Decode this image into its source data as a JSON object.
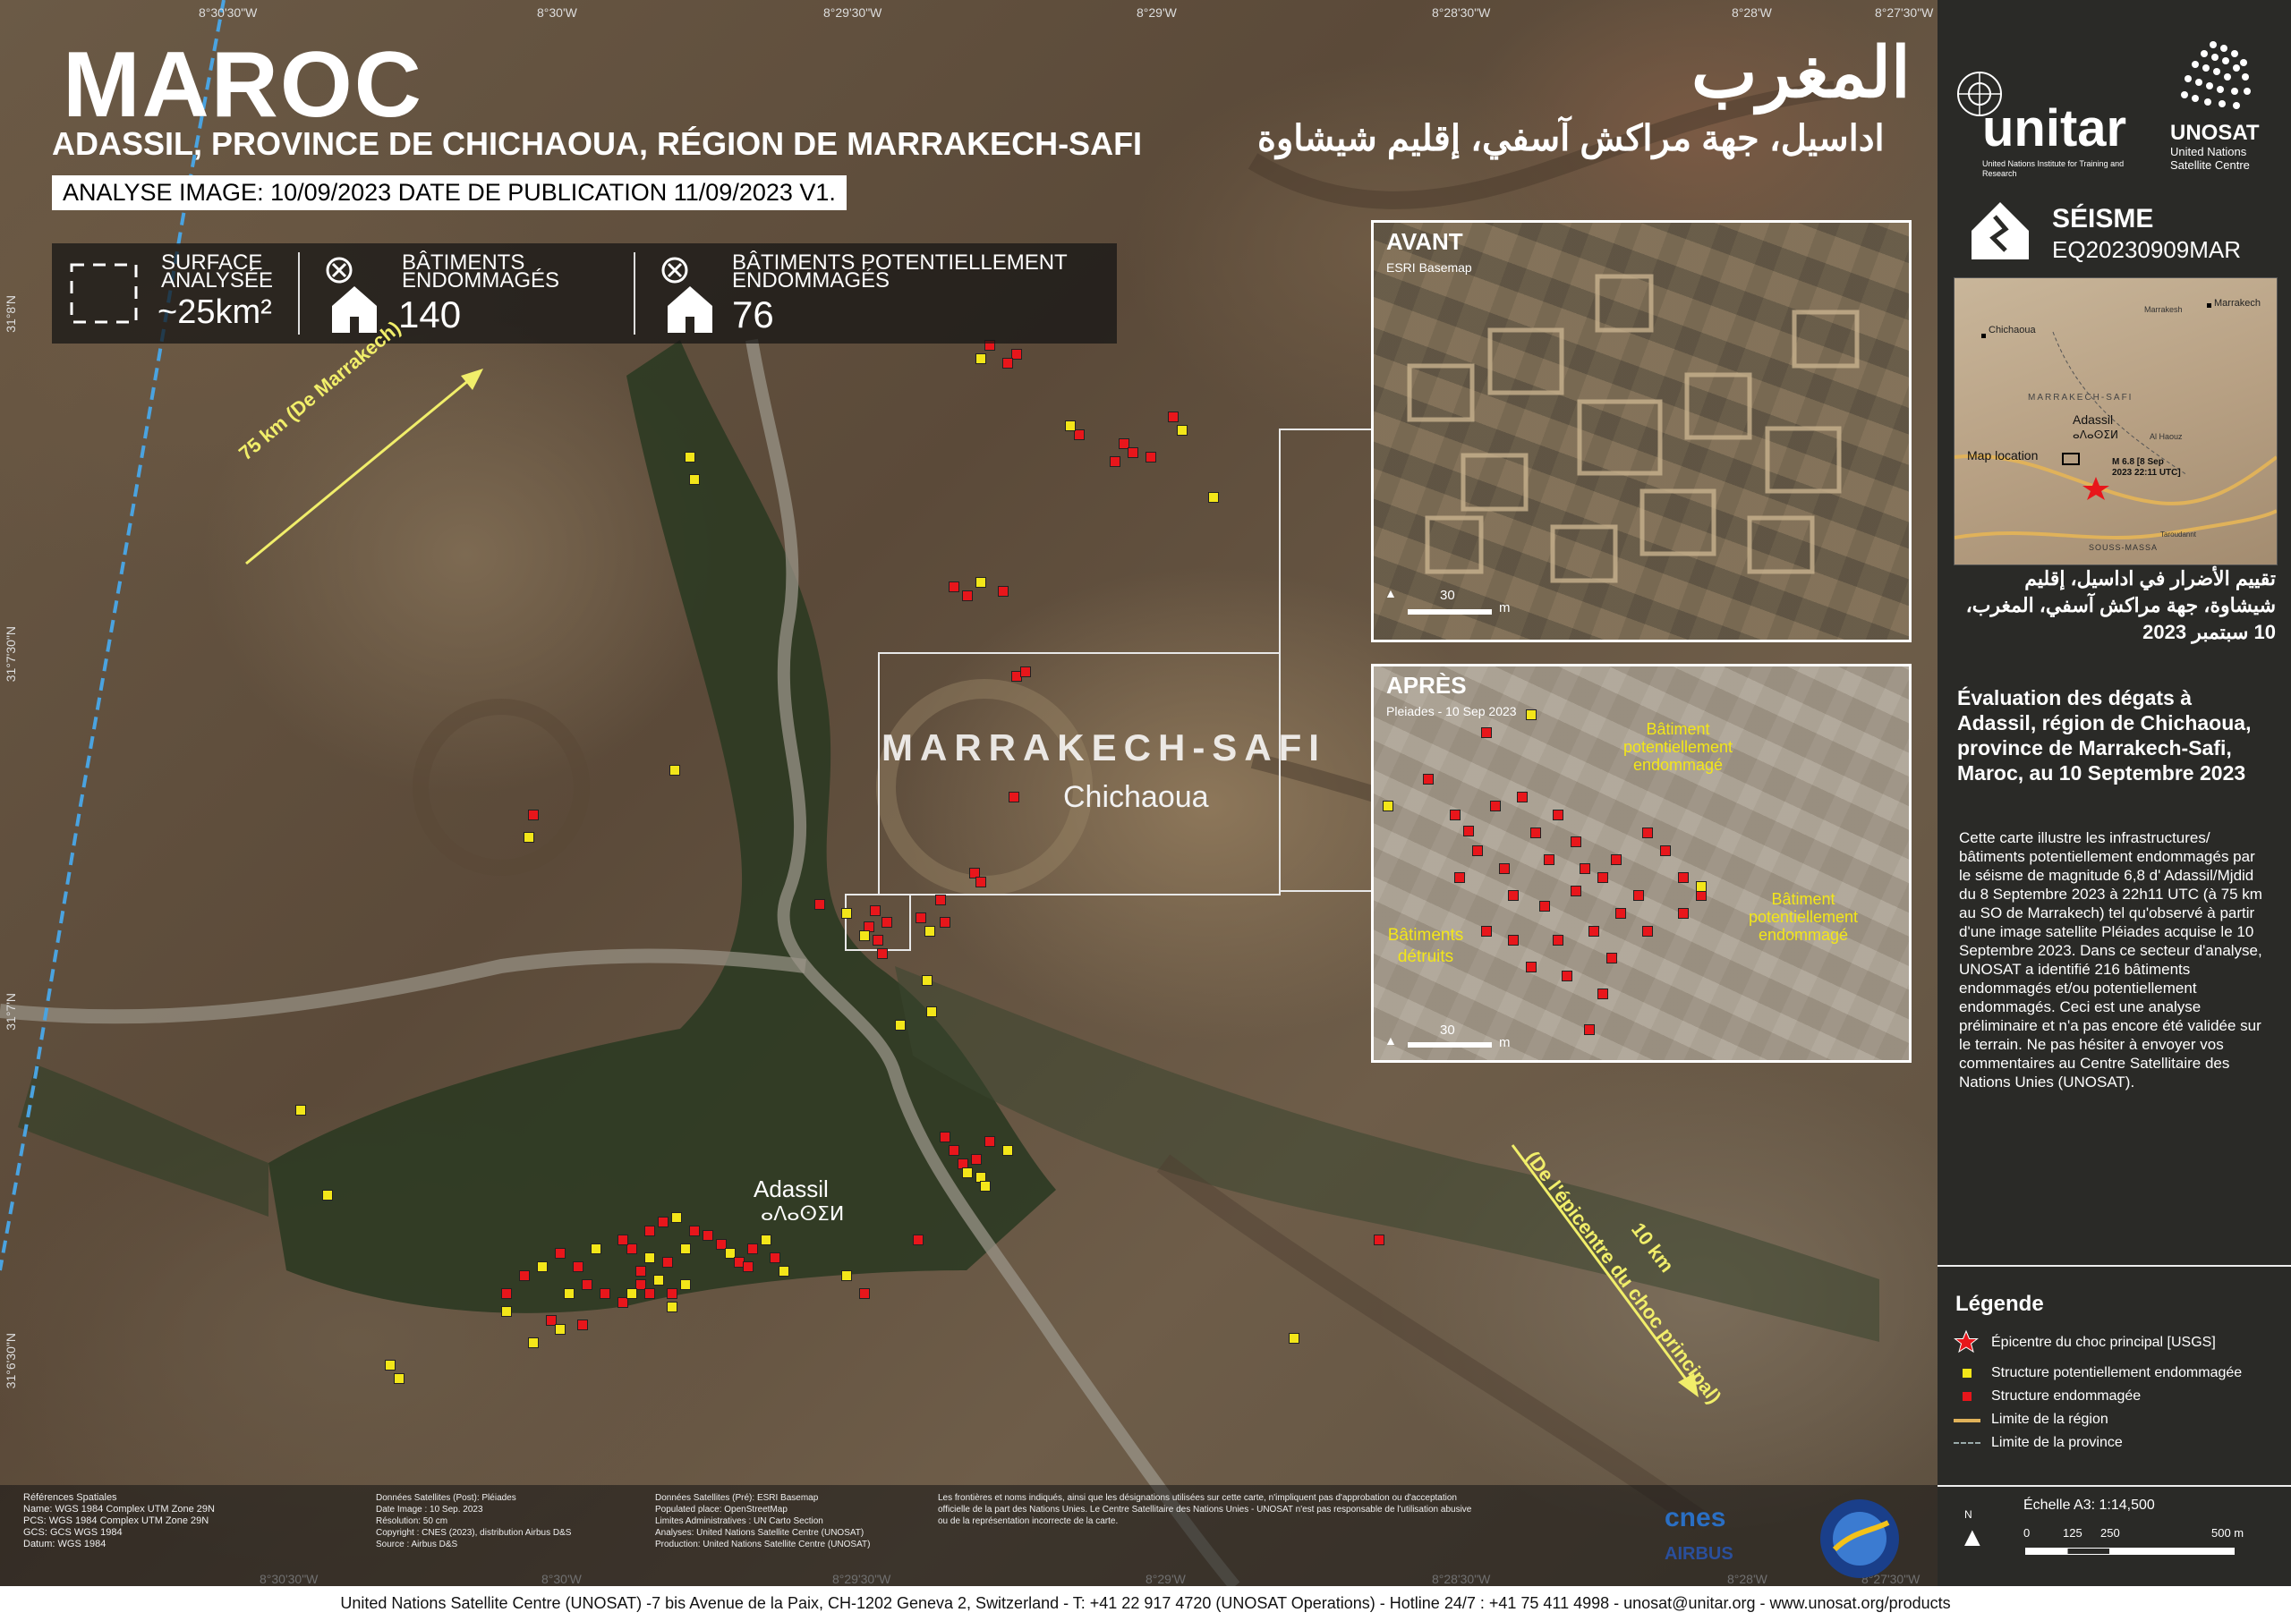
{
  "header": {
    "title": "MAROC",
    "title_ar": "المغرب",
    "subtitle": "ADASSIL, PROVINCE DE CHICHAOUA, RÉGION DE MARRAKECH-SAFI",
    "subtitle_ar": "اداسيل، جهة مراكش آسفي، إقليم شيشاوة",
    "analysis_line": "ANALYSE IMAGE: 10/09/2023 DATE DE PUBLICATION 11/09/2023 V1."
  },
  "stats": {
    "surface_label": "SURFACE ANALYSÉE",
    "surface_value": "~25km²",
    "damaged_label": "BÂTIMENTS ENDOMMAGÉS",
    "damaged_value": "140",
    "potential_label": "BÂTIMENTS POTENTIELLEMENT ENDOMMAGÉS",
    "potential_value": "76"
  },
  "map_labels": {
    "region": "MARRAKECH-SAFI",
    "province": "Chichaoua",
    "town": "Adassil",
    "town_tifinagh": "ⴰⴷⴰⵙⵉⵍ",
    "arrow_nw": "75 km (De Marrakech)",
    "arrow_se_line1": "10 km",
    "arrow_se_line2": "(De l'épicentre du choc principal)"
  },
  "coords_top": [
    "8°30'30\"W",
    "8°30'W",
    "8°29'30\"W",
    "8°29'W",
    "8°28'30\"W",
    "8°28'W",
    "8°27'30\"W"
  ],
  "coords_left": [
    "31°8'N",
    "31°7'30\"N",
    "31°7'N",
    "31°6'30\"N"
  ],
  "insets": {
    "before_label": "AVANT",
    "before_source": "ESRI Basemap",
    "after_label": "APRÈS",
    "after_source": "Pleiades - 10 Sep 2023",
    "scale_value": "30",
    "scale_unit": "m",
    "ann_potential": "Bâtiment potentiellement endommagé",
    "ann_destroyed_1": "Bâtiments",
    "ann_destroyed_2": "détruits"
  },
  "sidebar": {
    "unitar": "unitar",
    "unitar_sub": "United Nations Institute for Training and Research",
    "unosat": "UNOSAT",
    "unosat_sub": "United Nations Satellite Centre",
    "event_type": "SÉISME",
    "event_code": "EQ20230909MAR",
    "locmap": {
      "chichaoua": "Chichaoua",
      "marrakech": "Marrakech",
      "marrakech_lbl": "Marrakesh",
      "region": "MARRAKECH-SAFI",
      "adassil": "Adassil",
      "adassil_tif": "ⴰⴷⴰⵙⵉⵍ",
      "map_location": "Map location",
      "al_haouz": "Al Haouz",
      "epicenter": "M 6.8 [8 Sep 2023 22:11 UTC]",
      "souss": "SOUSS-MASSA",
      "taroudannt": "Taroudannt"
    },
    "title_ar": "تقييم الأضرار في اداسيل، إقليم شيشاوة، جهة مراكش آسفي، المغرب، 10 سبتمبر 2023",
    "title_fr": "Évaluation des dégats à Adassil, région de Chichaoua, province de Marrakech-Safi, Maroc, au 10 Septembre 2023",
    "body": "Cette carte illustre les infrastructures/ bâtiments potentiellement endommagés par le séisme de magnitude 6,8 d' Adassil/Mjdid du 8 Septembre 2023 à 22h11 UTC (à 75 km au SO de Marrakech)  tel qu'observé à partir d'une image satellite Pléiades acquise le 10 Septembre 2023. Dans ce secteur d'analyse, UNOSAT a identifié 216 bâtiments endommagés et/ou potentiellement endommagés. Ceci est une analyse préliminaire et n'a pas encore été validée sur le terrain. Ne pas hésiter à envoyer vos commentaires au Centre Satellitaire des Nations Unies (UNOSAT).",
    "legend_title": "Légende",
    "legend": [
      "Épicentre du choc principal [USGS]",
      "Structure potentiellement endommagée",
      "Structure endommagée",
      "Limite de la région",
      "Limite de la province"
    ],
    "scale_title": "Échelle A3: 1:14,500",
    "scale_ticks": [
      "0",
      "125",
      "250",
      "500 m"
    ],
    "north": "N"
  },
  "footer_meta": {
    "col1": [
      "Références Spatiales",
      "Name: WGS 1984 Complex UTM Zone 29N",
      "PCS: WGS 1984 Complex UTM Zone 29N",
      "GCS: GCS WGS 1984",
      "Datum: WGS 1984"
    ],
    "col2": [
      "Données Satellites (Post): Pléiades",
      "Date Image : 10 Sep. 2023",
      "Résolution: 50 cm",
      "Copyright : CNES (2023), distribution Airbus D&S",
      "Source : Airbus D&S"
    ],
    "col3": [
      "Données Satellites (Pré): ESRI Basemap",
      "Populated place: OpenStreetMap",
      "Limites Administratives : UN Carto Section",
      "",
      "Analyses: United Nations Satellite Centre (UNOSAT)",
      "Production: United Nations Satellite Centre (UNOSAT)"
    ],
    "col4": [
      "Les frontières et noms indiqués, ainsi que les désignations utilisées sur cette carte, n'impliquent pas d'approbation ou d'acceptation officielle de la part des Nations Unies. Le Centre Satellitaire des Nations Unies - UNOSAT n'est pas responsable de l'utilisation abusive ou de la représentation incorrecte de la carte."
    ],
    "cnes": "cnes",
    "airbus": "AIRBUS"
  },
  "footer": "United Nations Satellite Centre (UNOSAT) -7 bis Avenue de la Paix, CH-1202 Geneva 2, Switzerland - T: +41 22 917 4720 (UNOSAT Operations) - Hotline 24/7 : +41 75 411 4998 - unosat@unitar.org - www.unosat.org/products",
  "colors": {
    "damaged": "#e8161b",
    "potential": "#f3e619",
    "sidebar": "#2a2a27",
    "region_line": "#e0b25a"
  }
}
